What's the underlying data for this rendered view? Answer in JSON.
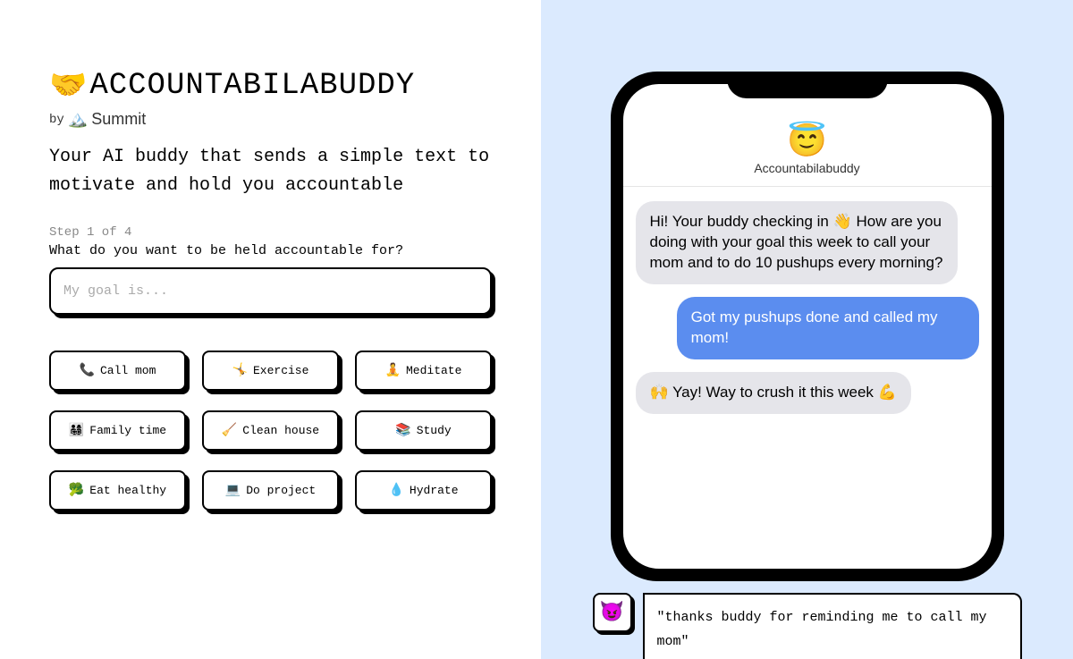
{
  "header": {
    "emoji": "🤝",
    "title": "ACCOUNTABILABUDDY",
    "by_prefix": "by",
    "by_emoji": "🏔️",
    "by_name": "Summit",
    "tagline": "Your AI buddy that sends a simple text to motivate and hold you accountable"
  },
  "form": {
    "step_label": "Step 1 of 4",
    "prompt": "What do you want to be held accountable for?",
    "input_placeholder": "My goal is..."
  },
  "suggestions": [
    {
      "emoji": "📞",
      "label": "Call mom"
    },
    {
      "emoji": "🤸",
      "label": "Exercise"
    },
    {
      "emoji": "🧘",
      "label": "Meditate"
    },
    {
      "emoji": "👨‍👩‍👧‍👦",
      "label": "Family time"
    },
    {
      "emoji": "🧹",
      "label": "Clean house"
    },
    {
      "emoji": "📚",
      "label": "Study"
    },
    {
      "emoji": "🥦",
      "label": "Eat healthy"
    },
    {
      "emoji": "💻",
      "label": "Do project"
    },
    {
      "emoji": "💧",
      "label": "Hydrate"
    }
  ],
  "phone": {
    "avatar_emoji": "😇",
    "contact_name": "Accountabilabuddy",
    "messages": [
      {
        "direction": "in",
        "text": "Hi! Your buddy checking in 👋 How are you doing with your goal this week to call your mom and to do 10 pushups every morning?"
      },
      {
        "direction": "out",
        "text": "Got my pushups done and called my mom!"
      },
      {
        "direction": "in",
        "text": "🙌 Yay!  Way to crush it this week 💪"
      }
    ]
  },
  "testimonial": {
    "avatar_emoji": "😈",
    "text": "\"thanks buddy for reminding me to call my mom\""
  }
}
